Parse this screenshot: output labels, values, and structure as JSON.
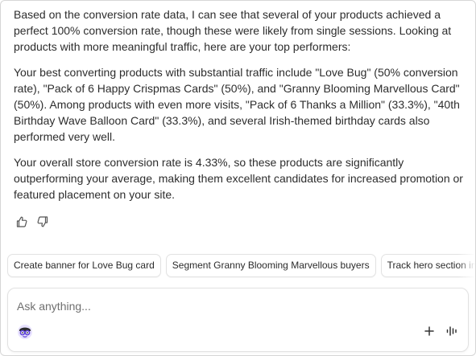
{
  "message": {
    "paragraphs": [
      "Based on the conversion rate data, I can see that several of your products achieved a perfect 100% conversion rate, though these were likely from single sessions. Looking at products with more meaningful traffic, here are your top performers:",
      "Your best converting products with substantial traffic include \"Love Bug\" (50% conversion rate), \"Pack of 6 Happy Crispmas Cards\" (50%), and \"Granny Blooming Marvellous Card\" (50%). Among products with even more visits, \"Pack of 6 Thanks a Million\" (33.3%), \"40th Birthday Wave Balloon Card\" (33.3%), and several Irish-themed birthday cards also performed very well.",
      "Your overall store conversion rate is 4.33%, so these products are significantly outperforming your average, making them excellent candidates for increased promotion or featured placement on your site."
    ]
  },
  "feedback": {
    "thumbs_up_icon": "thumbs-up-icon",
    "thumbs_down_icon": "thumbs-down-icon"
  },
  "suggestions": [
    "Create banner for Love Bug card",
    "Segment Granny Blooming Marvellous buyers",
    "Track hero section impressions"
  ],
  "composer": {
    "placeholder": "Ask anything...",
    "value": "",
    "avatar_icon": "assistant-avatar-icon",
    "plus_icon": "plus-icon",
    "voice_icon": "voice-waveform-icon"
  },
  "colors": {
    "text": "#2d2d2d",
    "border": "#e1e1e1",
    "avatar_purple": "#5b3fd6"
  }
}
